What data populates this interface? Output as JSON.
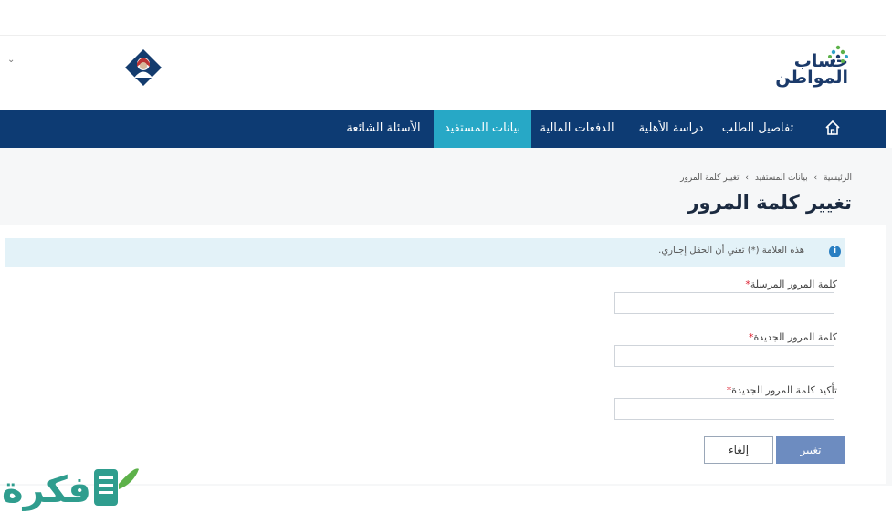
{
  "header": {
    "brand_line1": "حساب",
    "brand_line2": "المواطن",
    "chevron": "⌄"
  },
  "nav": {
    "home_icon": "home-icon",
    "items": [
      {
        "label": "تفاصيل الطلب"
      },
      {
        "label": "دراسة الأهلية"
      },
      {
        "label": "الدفعات المالية"
      },
      {
        "label": "بيانات المستفيد",
        "active": true
      },
      {
        "label": "الأسئلة الشائعة"
      }
    ],
    "active_color": "#27a8c6",
    "bar_color": "#0d3b73"
  },
  "breadcrumb": {
    "home": "الرئيسية",
    "sep1": "›",
    "parent": "بيانات المستفيد",
    "sep2": "›",
    "current": "تغيير كلمة المرور"
  },
  "page": {
    "title": "تغيير كلمة المرور"
  },
  "info": {
    "text": "هذه العلامة (*) تعني أن الحقل إجباري.",
    "icon": "info-icon"
  },
  "form": {
    "fields": [
      {
        "label": "كلمة المرور المرسلة",
        "required_mark": "*",
        "value": ""
      },
      {
        "label": "كلمة المرور الجديدة",
        "required_mark": "*",
        "value": ""
      },
      {
        "label": "تأكيد كلمة المرور الجديدة",
        "required_mark": "*",
        "value": ""
      }
    ],
    "submit_label": "تغيير",
    "cancel_label": "إلغاء"
  },
  "watermark": {
    "text": "فكرة"
  }
}
